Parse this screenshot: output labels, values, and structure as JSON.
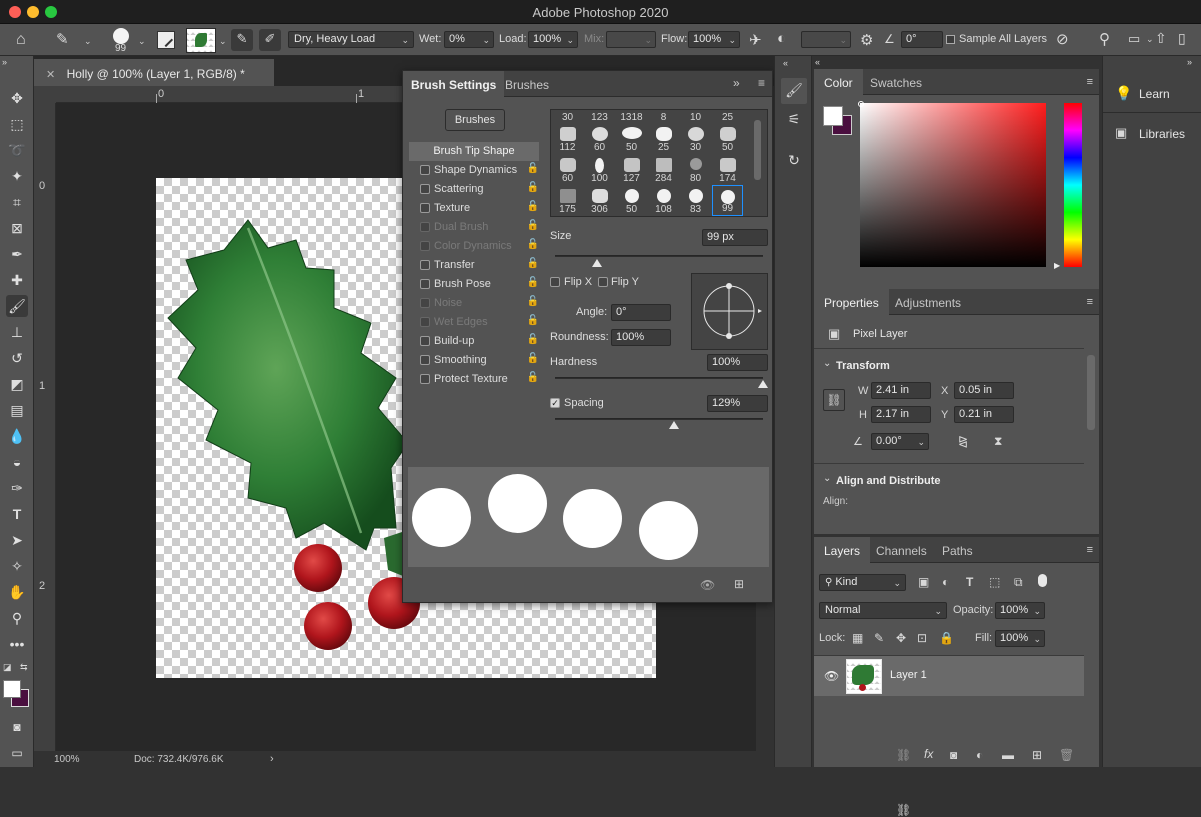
{
  "window": {
    "title": "Adobe Photoshop 2020"
  },
  "options_bar": {
    "brush_size": "99",
    "preset": "Dry, Heavy Load",
    "wet_label": "Wet:",
    "wet_value": "0%",
    "load_label": "Load:",
    "load_value": "100%",
    "mix_label": "Mix:",
    "mix_value": "",
    "flow_label": "Flow:",
    "flow_value": "100%",
    "angle_value": "0°",
    "sample_all_layers": "Sample All Layers"
  },
  "document": {
    "tab_title": "Holly @ 100% (Layer 1, RGB/8) *",
    "ruler_h": [
      "0",
      "1"
    ],
    "ruler_v": [
      "0",
      "1",
      "2"
    ],
    "zoom": "100%",
    "doc_info": "Doc: 732.4K/976.6K"
  },
  "brush_settings": {
    "tabs": [
      "Brush Settings",
      "Brushes"
    ],
    "brushes_button": "Brushes",
    "options": [
      {
        "label": "Brush Tip Shape",
        "type": "header"
      },
      {
        "label": "Shape Dynamics",
        "enabled": true
      },
      {
        "label": "Scattering",
        "enabled": true
      },
      {
        "label": "Texture",
        "enabled": true
      },
      {
        "label": "Dual Brush",
        "enabled": false
      },
      {
        "label": "Color Dynamics",
        "enabled": false
      },
      {
        "label": "Transfer",
        "enabled": true
      },
      {
        "label": "Brush Pose",
        "enabled": true
      },
      {
        "label": "Noise",
        "enabled": false
      },
      {
        "label": "Wet Edges",
        "enabled": false
      },
      {
        "label": "Build-up",
        "enabled": true
      },
      {
        "label": "Smoothing",
        "enabled": true
      },
      {
        "label": "Protect Texture",
        "enabled": true
      }
    ],
    "tips_top": [
      "30",
      "123",
      "1318",
      "8",
      "10",
      "25"
    ],
    "tips": [
      [
        "112",
        "60",
        "50",
        "25",
        "30",
        "50"
      ],
      [
        "60",
        "100",
        "127",
        "284",
        "80",
        "174"
      ],
      [
        "175",
        "306",
        "50",
        "108",
        "83",
        "99"
      ]
    ],
    "size_label": "Size",
    "size_value": "99 px",
    "flip_x": "Flip X",
    "flip_y": "Flip Y",
    "angle_label": "Angle:",
    "angle_value": "0°",
    "roundness_label": "Roundness:",
    "roundness_value": "100%",
    "hardness_label": "Hardness",
    "hardness_value": "100%",
    "spacing_label": "Spacing",
    "spacing_value": "129%",
    "sliders": {
      "size": 0.2,
      "hardness": 1.0,
      "spacing": 0.57
    }
  },
  "color_panel": {
    "tabs": [
      "Color",
      "Swatches"
    ],
    "foreground": "#ffffff",
    "background": "#4a0f3f"
  },
  "properties_panel": {
    "tabs": [
      "Properties",
      "Adjustments"
    ],
    "layer_kind": "Pixel Layer",
    "transform_header": "Transform",
    "w_label": "W",
    "w_value": "2.41 in",
    "h_label": "H",
    "h_value": "2.17 in",
    "x_label": "X",
    "x_value": "0.05 in",
    "y_label": "Y",
    "y_value": "0.21 in",
    "angle_value": "0.00°",
    "align_header": "Align and Distribute",
    "align_label": "Align:"
  },
  "layers_panel": {
    "tabs": [
      "Layers",
      "Channels",
      "Paths"
    ],
    "filter_kind": "Kind",
    "blend_mode": "Normal",
    "opacity_label": "Opacity:",
    "opacity_value": "100%",
    "lock_label": "Lock:",
    "fill_label": "Fill:",
    "fill_value": "100%",
    "layers": [
      {
        "name": "Layer 1",
        "visible": true
      }
    ]
  },
  "learn_panel": {
    "learn": "Learn",
    "libraries": "Libraries"
  }
}
